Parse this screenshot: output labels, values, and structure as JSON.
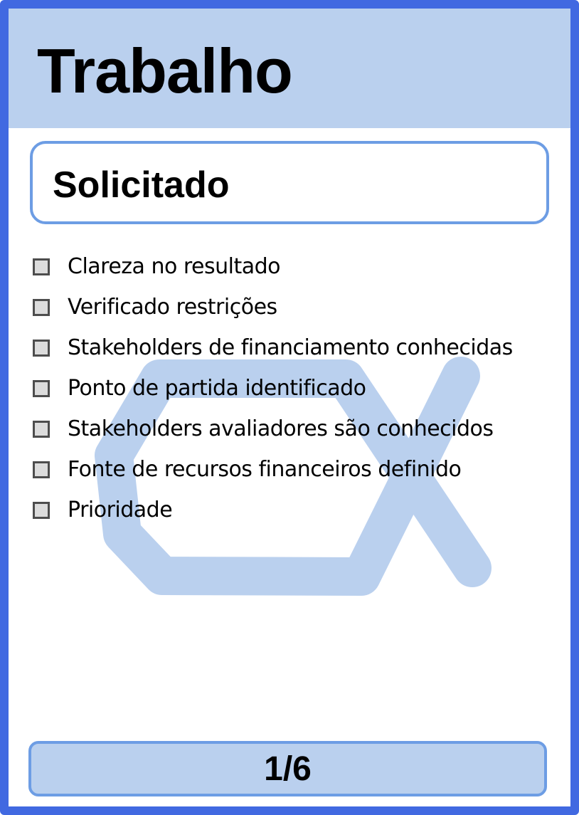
{
  "card": {
    "title": "Trabalho",
    "state": "Solicitado",
    "checklist": [
      {
        "label": "Clareza no resultado",
        "checked": false
      },
      {
        "label": "Verificado restrições",
        "checked": false
      },
      {
        "label": "Stakeholders de financiamento conhecidas",
        "checked": false
      },
      {
        "label": "Ponto de partida identificado",
        "checked": false
      },
      {
        "label": "Stakeholders avaliadores são conhecidos",
        "checked": false
      },
      {
        "label": "Fonte de recursos financeiros definido",
        "checked": false
      },
      {
        "label": "Prioridade",
        "checked": false
      }
    ],
    "page_indicator": "1/6"
  },
  "colors": {
    "border": "#4169e1",
    "header_bg": "#bad0ee",
    "box_border": "#6d9de4",
    "watermark": "#bad0ee",
    "checkbox_fill": "#dcdcdc"
  },
  "icons": {
    "watermark": "alpha-state-icon"
  }
}
